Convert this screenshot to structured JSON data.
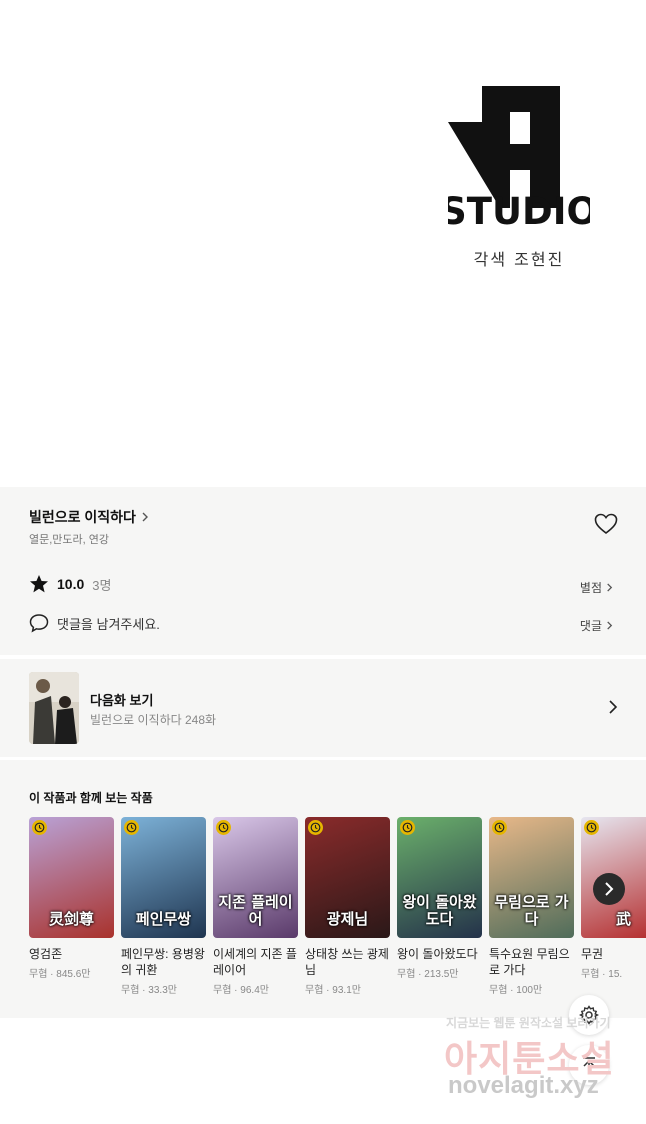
{
  "studio": {
    "logo_text": "STUDIO",
    "credit": "각색 조현진"
  },
  "work": {
    "title": "빌런으로 이직하다",
    "tags": "열문,만도라, 연강",
    "rating_score": "10.0",
    "rating_count": "3명",
    "rate_label": "별점",
    "comment_placeholder": "댓글을 남겨주세요.",
    "comment_label": "댓글"
  },
  "next_episode": {
    "title": "다음화 보기",
    "subtitle": "빌런으로 이직하다 248화"
  },
  "recommend": {
    "heading": "이 작품과 함께 보는 작품",
    "items": [
      {
        "title": "영검존",
        "meta": "무협 · 845.6만",
        "cover_text": "灵剑尊",
        "colors": [
          "#b9a2d6",
          "#a9322c"
        ]
      },
      {
        "title": "페인무쌍: 용병왕의 귀환",
        "meta": "무협 · 33.3만",
        "cover_text": "페인무쌍",
        "colors": [
          "#7db2d8",
          "#1f3550"
        ]
      },
      {
        "title": "이세계의 지존 플레이어",
        "meta": "무협 · 96.4만",
        "cover_text": "지존 플레이어",
        "colors": [
          "#d9c7e8",
          "#5a3a6a"
        ]
      },
      {
        "title": "상태창 쓰는 광제님",
        "meta": "무협 · 93.1만",
        "cover_text": "광제님",
        "colors": [
          "#8a2b2b",
          "#2a1818"
        ]
      },
      {
        "title": "왕이 돌아왔도다",
        "meta": "무협 · 213.5만",
        "cover_text": "왕이 돌아왔도다",
        "colors": [
          "#6bb06b",
          "#24324a"
        ]
      },
      {
        "title": "특수요원 무림으로 가다",
        "meta": "무협 · 100만",
        "cover_text": "무림으로 가다",
        "colors": [
          "#e8b889",
          "#4f6c5a"
        ]
      },
      {
        "title": "무권",
        "meta": "무협 · 15.",
        "cover_text": "武",
        "colors": [
          "#e6e6f0",
          "#b32828"
        ]
      }
    ]
  },
  "watermark": {
    "line1": "지금보는 웹툰 원작소설 보러가기",
    "line2": "아지툰소설",
    "line3": "novelagit.xyz"
  },
  "icons": {
    "chevron": "chevron-right-icon",
    "heart": "heart-icon",
    "star": "star-icon",
    "comment": "speech-bubble-icon",
    "clock": "clock-icon",
    "gear": "gear-icon",
    "top": "arrow-up-icon"
  },
  "colors": {
    "panel_bg": "#f6f6f5",
    "badge": "#e5b600",
    "text": "#222222"
  }
}
